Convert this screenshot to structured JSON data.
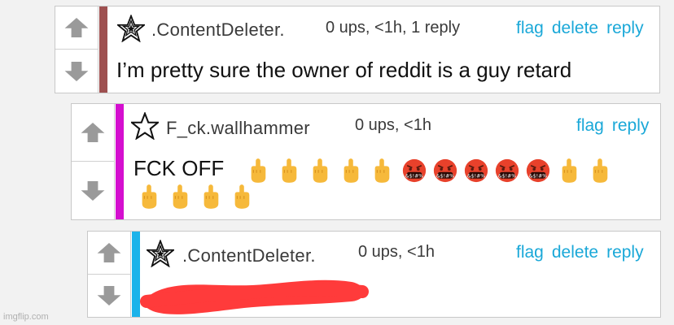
{
  "watermark": "imgflip.com",
  "colors": {
    "link": "#1aa8d8",
    "arrow": "#9a9a9a",
    "stripe_1": "#9e5050",
    "stripe_2": "#d40fcf",
    "stripe_3": "#1cb3ea",
    "scribble": "#ff3b3b"
  },
  "comments": [
    {
      "username": ".ContentDeleter.",
      "meta": "0 ups, <1h, 1 reply",
      "actions": [
        "flag",
        "delete",
        "reply"
      ],
      "body": "I’m pretty sure the owner of reddit is a guy retard"
    },
    {
      "username": "F_ck.wallhammer",
      "meta": "0 ups, <1h",
      "actions": [
        "flag",
        "reply"
      ],
      "body": "FCK OFF",
      "emoji_row1": [
        "middle-finger",
        "middle-finger",
        "middle-finger",
        "middle-finger",
        "middle-finger",
        "cursing-face",
        "cursing-face",
        "cursing-face",
        "cursing-face",
        "cursing-face",
        "middle-finger",
        "middle-finger"
      ],
      "emoji_row2": [
        "middle-finger",
        "middle-finger",
        "middle-finger",
        "middle-finger"
      ]
    },
    {
      "username": ".ContentDeleter.",
      "meta": "0 ups, <1h",
      "actions": [
        "flag",
        "delete",
        "reply"
      ],
      "body_redacted": true
    }
  ]
}
